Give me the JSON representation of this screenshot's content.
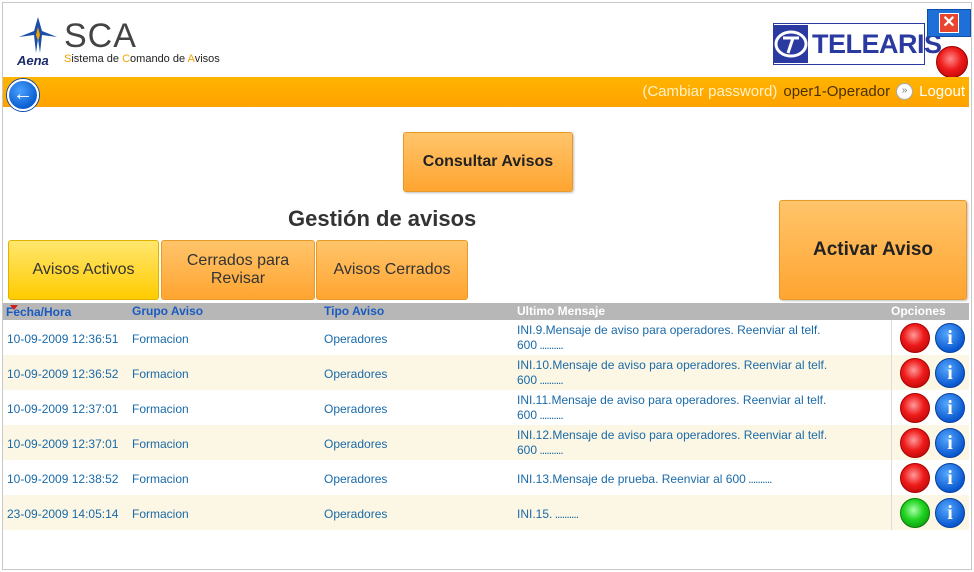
{
  "header": {
    "aena_text": "Aena",
    "app_title": "SCA",
    "app_subtitle_parts": [
      "S",
      "istema de ",
      "C",
      "omando de ",
      "A",
      "visos"
    ],
    "partner_logo": "TELEARIS",
    "close_icon": "close-icon",
    "status_color": "#ee1a1a"
  },
  "topbar": {
    "change_password": "(Cambiar password)",
    "user": "oper1-Operador",
    "logout": "Logout",
    "accent": "#ffa200"
  },
  "main": {
    "consult_button": "Consultar Avisos",
    "section_title": "Gestión de avisos",
    "activate_button": "Activar Aviso",
    "tabs": [
      {
        "label": "Avisos Activos",
        "selected": true
      },
      {
        "label": "Cerrados para Revisar",
        "selected": false
      },
      {
        "label": "Avisos Cerrados",
        "selected": false
      }
    ]
  },
  "table": {
    "columns": [
      "Fecha/Hora",
      "Grupo Aviso",
      "Tipo Aviso",
      "Ultimo Mensaje",
      "Opciones"
    ],
    "rows": [
      {
        "fecha": "10-09-2009 12:36:51",
        "grupo": "Formacion",
        "tipo": "Operadores",
        "mensaje_1": "INI.9.Mensaje de aviso para operadores. Reenviar al telf.",
        "mensaje_2": "600",
        "status": "red"
      },
      {
        "fecha": "10-09-2009 12:36:52",
        "grupo": "Formacion",
        "tipo": "Operadores",
        "mensaje_1": "INI.10.Mensaje de aviso para operadores. Reenviar al telf.",
        "mensaje_2": "600",
        "status": "red"
      },
      {
        "fecha": "10-09-2009 12:37:01",
        "grupo": "Formacion",
        "tipo": "Operadores",
        "mensaje_1": "INI.11.Mensaje de aviso para operadores. Reenviar al telf.",
        "mensaje_2": "600",
        "status": "red"
      },
      {
        "fecha": "10-09-2009 12:37:01",
        "grupo": "Formacion",
        "tipo": "Operadores",
        "mensaje_1": "INI.12.Mensaje de aviso para operadores. Reenviar al telf.",
        "mensaje_2": "600",
        "status": "red"
      },
      {
        "fecha": "10-09-2009 12:38:52",
        "grupo": "Formacion",
        "tipo": "Operadores",
        "mensaje_1": "INI.13.Mensaje de prueba. Reenviar al 600",
        "mensaje_2": "",
        "status": "red"
      },
      {
        "fecha": "23-09-2009 14:05:14",
        "grupo": "Formacion",
        "tipo": "Operadores",
        "mensaje_1": "INI.15.",
        "mensaje_2": "",
        "status": "green"
      }
    ]
  }
}
